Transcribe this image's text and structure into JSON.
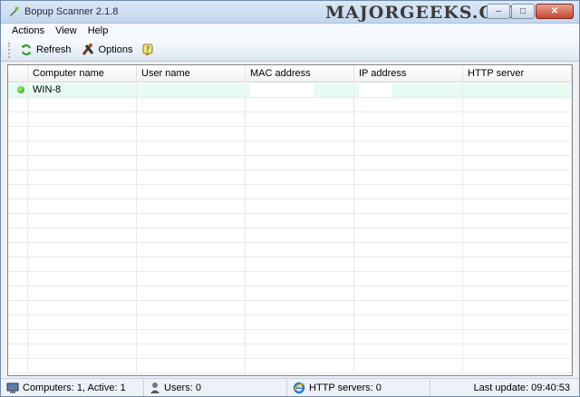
{
  "window": {
    "title": "Bopup Scanner 2.1.8",
    "watermark": "MAJORGEEKS.COM",
    "controls": {
      "minimize": "–",
      "maximize": "□",
      "close": "✕"
    }
  },
  "menu": {
    "items": [
      {
        "label": "Actions"
      },
      {
        "label": "View"
      },
      {
        "label": "Help"
      }
    ]
  },
  "toolbar": {
    "refresh_label": "Refresh",
    "options_label": "Options",
    "icons": [
      "refresh-icon",
      "options-icon",
      "help-icon"
    ]
  },
  "table": {
    "columns": [
      "Computer name",
      "User name",
      "MAC address",
      "IP address",
      "HTTP server"
    ],
    "rows": [
      {
        "computer_name": "WIN-8",
        "user_name": "",
        "mac_address": "",
        "ip_address": "",
        "http_server": "",
        "status": "online"
      }
    ]
  },
  "statusbar": {
    "computers": "Computers: 1, Active: 1",
    "users": "Users: 0",
    "http_servers": "HTTP servers: 0",
    "last_update": "Last update: 09:40:53"
  },
  "colors": {
    "active_row": "#e8fbf3",
    "online_dot": "#3aa81a",
    "titlebar": "#c4d6ee"
  }
}
